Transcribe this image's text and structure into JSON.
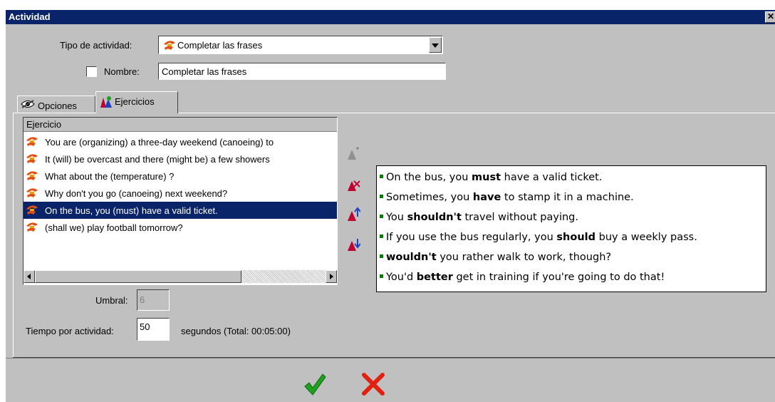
{
  "window": {
    "title": "Actividad",
    "close_glyph": "✕"
  },
  "form": {
    "type_label": "Tipo de actividad:",
    "type_value": "Completar las frases",
    "name_label": "Nombre:",
    "name_value": "Completar las frases",
    "name_checked": false
  },
  "tabs": [
    {
      "label": "Opciones",
      "icon": "eye-icon",
      "active": false
    },
    {
      "label": "Ejercicios",
      "icon": "exercises-icon",
      "active": true
    }
  ],
  "exercise_list": {
    "header": "Ejercicio",
    "rows": [
      {
        "text": "You are (organizing) a three-day weekend (canoeing) to",
        "selected": false
      },
      {
        "text": "It (will) be overcast and there (might be) a few showers",
        "selected": false
      },
      {
        "text": "What about the (temperature) ?",
        "selected": false
      },
      {
        "text": "Why don't you go (canoeing) next weekend?",
        "selected": false
      },
      {
        "text": "On the bus, you (must) have a valid ticket.",
        "selected": true
      },
      {
        "text": "(shall we) play football tomorrow?",
        "selected": false
      }
    ]
  },
  "side_tools": [
    {
      "name": "add-exercise-button",
      "enabled": false
    },
    {
      "name": "delete-exercise-button",
      "enabled": true
    },
    {
      "name": "move-up-button",
      "enabled": true
    },
    {
      "name": "move-down-button",
      "enabled": true
    }
  ],
  "preview": {
    "lines": [
      {
        "pre": "On the bus, you ",
        "bold": "must",
        "post": " have a valid ticket."
      },
      {
        "pre": "Sometimes, you ",
        "bold": "have",
        "post": " to stamp it in a machine."
      },
      {
        "pre": "You ",
        "bold": "shouldn't",
        "post": " travel without paying."
      },
      {
        "pre": "If you use the bus regularly, you ",
        "bold": "should",
        "post": " buy a weekly pass."
      },
      {
        "pre": "",
        "bold": "wouldn't",
        "post": " you rather walk to work, though?"
      },
      {
        "pre": "You'd ",
        "bold": "better",
        "post": " get in training if you're going to do that!"
      }
    ]
  },
  "threshold": {
    "label": "Umbral:",
    "value": "6"
  },
  "time": {
    "label": "Tiempo por actividad:",
    "value": "50",
    "suffix": "segundos (Total: 00:05:00)"
  },
  "colors": {
    "titlebar": "#0a246a",
    "face": "#c0c0c0",
    "ok": "#1fa01f",
    "cancel": "#e02010",
    "bullet": "#008000"
  }
}
